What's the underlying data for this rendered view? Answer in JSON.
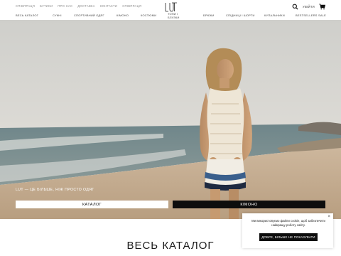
{
  "header": {
    "top_links": [
      "Співпраця",
      "Бутики",
      "Про нас",
      "Доставка",
      "Контакти",
      "Співпраця"
    ],
    "login_label": "Увійти",
    "logo_icon": "brand-logo-icon",
    "search_icon": "search-icon",
    "cart_icon": "cart-icon"
  },
  "nav": {
    "items": [
      "Весь каталог",
      "Сукні",
      "Спортивний одяг",
      "Кімоно",
      "Костюми",
      "Топи і\nблузки",
      "Брюки",
      "Спідниці і шорти",
      "Купальники",
      "Bestsellers",
      "Sale"
    ]
  },
  "hero": {
    "caption": "LUT — це більше, ніж просто одяг",
    "catalog_button": "Каталог",
    "kimono_button": "Кімоно"
  },
  "section": {
    "title": "Весь каталог"
  },
  "cookie": {
    "text": "Ми використовуємо файли cookie, щоб забезпечити найкращу роботу сайту.",
    "button": "Добре, більше не показувати",
    "close": "×"
  },
  "colors": {
    "accent": "#0d0d0d",
    "sky": "#d4d4d0",
    "sea": "#5f7a80",
    "sand": "#c7b29a"
  }
}
